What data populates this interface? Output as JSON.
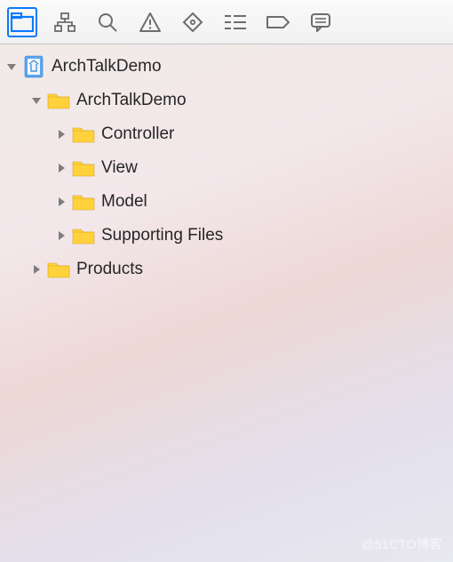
{
  "toolbar": {
    "selected_index": 0,
    "icons": [
      "folder",
      "hierarchy",
      "search",
      "warning",
      "diamond",
      "list",
      "tag",
      "comment"
    ]
  },
  "tree": {
    "root": {
      "label": "ArchTalkDemo",
      "expanded": true,
      "type": "project",
      "children": [
        {
          "label": "ArchTalkDemo",
          "expanded": true,
          "type": "folder",
          "children": [
            {
              "label": "Controller",
              "expanded": false,
              "type": "folder"
            },
            {
              "label": "View",
              "expanded": false,
              "type": "folder"
            },
            {
              "label": "Model",
              "expanded": false,
              "type": "folder"
            },
            {
              "label": "Supporting Files",
              "expanded": false,
              "type": "folder"
            }
          ]
        },
        {
          "label": "Products",
          "expanded": false,
          "type": "folder"
        }
      ]
    }
  },
  "watermark": "@51CTO博客"
}
